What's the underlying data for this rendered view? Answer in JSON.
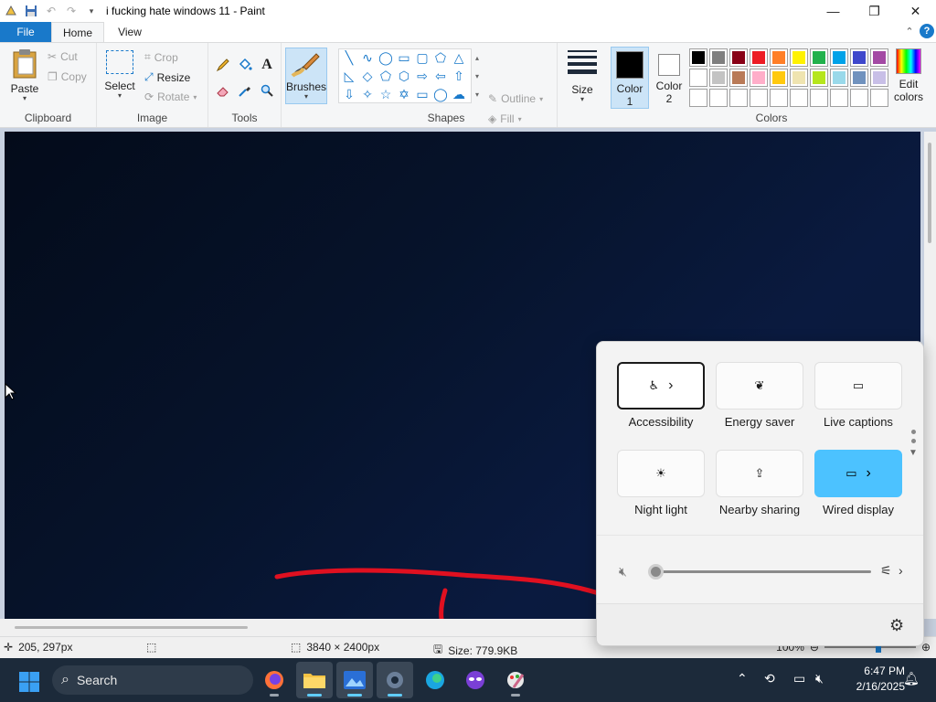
{
  "window": {
    "title": "i fucking hate windows 11 - Paint",
    "minimize_icon": "minimize-icon",
    "maximize_icon": "maximize-icon",
    "close_icon": "close-icon"
  },
  "tabs": {
    "file": "File",
    "home": "Home",
    "view": "View"
  },
  "clipboard": {
    "paste": "Paste",
    "cut": "Cut",
    "copy": "Copy",
    "label": "Clipboard"
  },
  "image": {
    "select": "Select",
    "crop": "Crop",
    "resize": "Resize",
    "rotate": "Rotate",
    "label": "Image"
  },
  "tools": {
    "label": "Tools"
  },
  "brushes": {
    "label": "Brushes"
  },
  "shapes": {
    "outline": "Outline",
    "fill": "Fill",
    "label": "Shapes"
  },
  "size": {
    "label": "Size"
  },
  "colors": {
    "color1": "Color 1",
    "color1_line1": "Color",
    "color1_line2": "1",
    "color2_line1": "Color",
    "color2_line2": "2",
    "edit_line1": "Edit",
    "edit_line2": "colors",
    "label": "Colors",
    "palette_row1": [
      "#000000",
      "#7f7f7f",
      "#880015",
      "#ed1c24",
      "#ff7f27",
      "#fff200",
      "#22b14c",
      "#00a2e8",
      "#3f48cc",
      "#a349a4"
    ],
    "palette_row2": [
      "#ffffff",
      "#c3c3c3",
      "#b97a57",
      "#ffaec9",
      "#ffc90e",
      "#efe4b0",
      "#b5e61d",
      "#99d9ea",
      "#7092be",
      "#c8bfe7"
    ],
    "color1_value": "#000000",
    "color2_value": "#ffffff"
  },
  "status": {
    "cursor": "205, 297px",
    "dimensions": "3840 × 2400px",
    "size": "Size: 779.9KB",
    "zoom": "100%"
  },
  "quick_settings": {
    "tiles": [
      {
        "label": "Accessibility",
        "icon": "accessibility-icon",
        "has_arrow": true,
        "selected": true,
        "on": false
      },
      {
        "label": "Energy saver",
        "icon": "leaf-icon",
        "has_arrow": false,
        "selected": false,
        "on": false
      },
      {
        "label": "Live captions",
        "icon": "captions-icon",
        "has_arrow": false,
        "selected": false,
        "on": false
      },
      {
        "label": "Night light",
        "icon": "night-light-icon",
        "has_arrow": false,
        "selected": false,
        "on": false
      },
      {
        "label": "Nearby sharing",
        "icon": "share-icon",
        "has_arrow": false,
        "selected": false,
        "on": false
      },
      {
        "label": "Wired display",
        "icon": "cast-icon",
        "has_arrow": true,
        "selected": false,
        "on": true
      }
    ],
    "volume_level": 0,
    "volume_muted": true
  },
  "taskbar": {
    "search": "Search",
    "time": "6:47 PM",
    "date": "2/16/2025"
  }
}
